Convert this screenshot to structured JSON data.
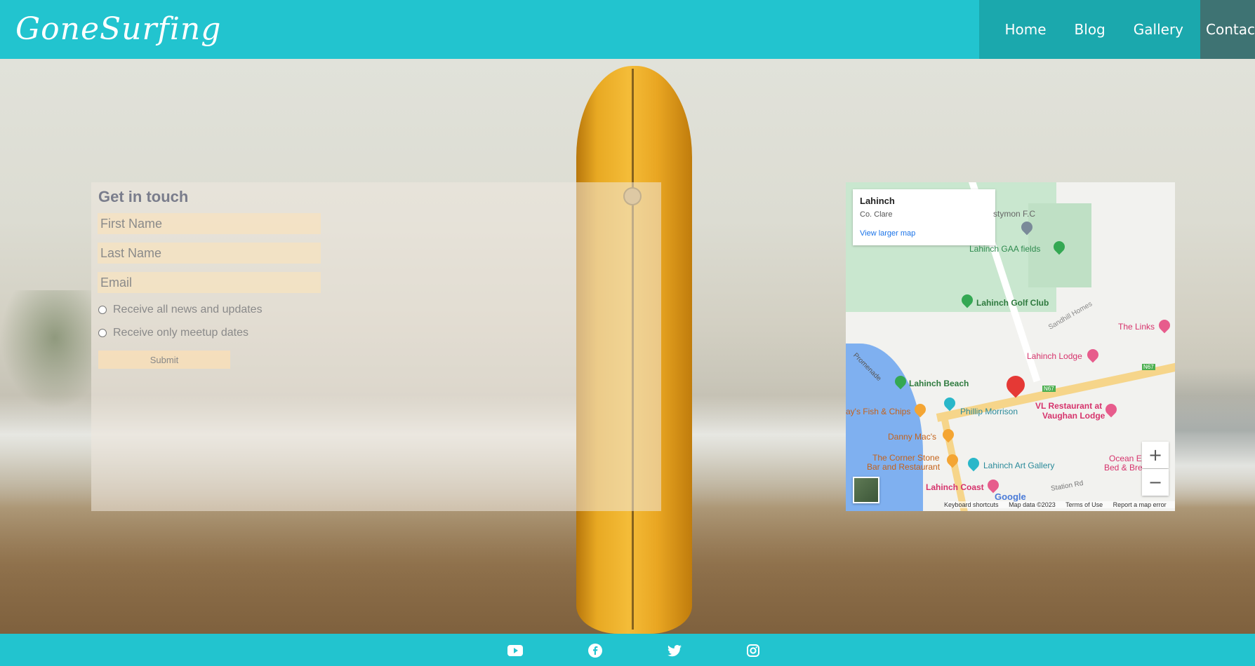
{
  "site": {
    "logo_text": "GoneSurfing"
  },
  "nav": {
    "items": [
      {
        "label": "Home"
      },
      {
        "label": "Blog"
      },
      {
        "label": "Gallery"
      }
    ],
    "active_label": "Contact"
  },
  "form": {
    "title": "Get in touch",
    "first_name_placeholder": "First Name",
    "last_name_placeholder": "Last Name",
    "email_placeholder": "Email",
    "radio_1_label": "Receive all news and updates",
    "radio_2_label": "Receive only meetup dates",
    "submit_label": "Submit"
  },
  "map": {
    "info_title": "Lahinch",
    "info_subtitle": "Co. Clare",
    "info_link": "View larger map",
    "labels": {
      "ennistymon_fc": "stymon F.C",
      "gaa": "Lahinch GAA fields",
      "golf": "Lahinch Golf Club",
      "sandhill": "Sandhill Homes",
      "links": "The Links",
      "lodge": "Lahinch Lodge",
      "promenade": "Promenade",
      "beach": "Lahinch Beach",
      "n67_a": "N67",
      "n67_b": "N67",
      "fish": "ay's Fish & Chips",
      "phillip": "Phillip Morrison",
      "vl": "VL Restaurant at",
      "vl2": "Vaughan Lodge",
      "danny": "Danny Mac's",
      "corner": "The Corner Stone",
      "corner2": "Bar and Restaurant",
      "art": "Lahinch Art Gallery",
      "ocean": "Ocean E",
      "ocean2": "Bed & Bre",
      "coast": "Lahinch Coast",
      "station": "Station Rd"
    },
    "zoom_in": "+",
    "zoom_out": "−",
    "google": "Google",
    "footer": {
      "shortcuts": "Keyboard shortcuts",
      "data": "Map data ©2023",
      "terms": "Terms of Use",
      "report": "Report a map error"
    }
  },
  "footer": {
    "icons": [
      "youtube-icon",
      "facebook-icon",
      "twitter-icon",
      "instagram-icon"
    ]
  },
  "colors": {
    "header_bg": "#22c4cf",
    "nav_bg": "#1ba8ad",
    "nav_active_bg": "#3e7373"
  }
}
